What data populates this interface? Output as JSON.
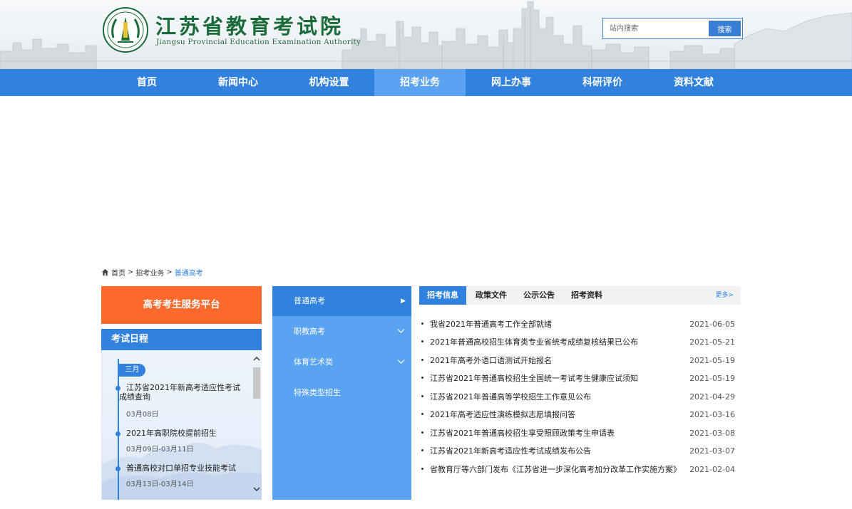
{
  "header": {
    "title": "江苏省教育考试院",
    "subtitle": "Jiangsu Provincial Education Examination Authority",
    "search": {
      "placeholder": "站内搜索",
      "button": "搜索"
    }
  },
  "nav": {
    "items": [
      "首页",
      "新闻中心",
      "机构设置",
      "招考业务",
      "网上办事",
      "科研评价",
      "资料文献"
    ],
    "active": "招考业务"
  },
  "breadcrumb": {
    "home": "首页",
    "section": "招考业务",
    "current": "普通高考"
  },
  "left": {
    "service_button": "高考考生服务平台",
    "schedule_title": "考试日程",
    "month": "三月",
    "events": [
      {
        "title": "江苏省2021年新高考适应性考试成绩查询",
        "date": "03月08日"
      },
      {
        "title": "2021年高职院校提前招生",
        "date": "03月09日-03月11日"
      },
      {
        "title": "普通高校对口单招专业技能考试",
        "date": "03月13日-03月14日"
      }
    ]
  },
  "categories": [
    {
      "label": "普通高考",
      "active": true
    },
    {
      "label": "职教高考"
    },
    {
      "label": "体育艺术类"
    },
    {
      "label": "特殊类型招生"
    }
  ],
  "tabs": [
    "招考信息",
    "政策文件",
    "公示公告",
    "招考资料"
  ],
  "more": "更多>",
  "news": [
    {
      "title": "我省2021年普通高考工作全部就绪",
      "date": "2021-06-05"
    },
    {
      "title": "2021年普通高校招生体育类专业省统考成绩复核结果已公布",
      "date": "2021-05-21"
    },
    {
      "title": "2021年高考外语口语测试开始报名",
      "date": "2021-05-19"
    },
    {
      "title": "江苏省2021年普通高校招生全国统一考试考生健康应试须知",
      "date": "2021-05-19"
    },
    {
      "title": "江苏省2021年普通高等学校招生工作意见公布",
      "date": "2021-04-29"
    },
    {
      "title": "2021年高考适应性演练模拟志愿填报问答",
      "date": "2021-03-16"
    },
    {
      "title": "江苏省2021年普通高校招生享受照顾政策考生申请表",
      "date": "2021-03-08"
    },
    {
      "title": "江苏省2021年新高考适应性考试成绩发布公告",
      "date": "2021-03-07"
    },
    {
      "title": "省教育厅等六部门发布《江苏省进一步深化高考加分改革工作实施方案》",
      "date": "2021-02-04"
    }
  ],
  "colors": {
    "primary": "#3181de",
    "nav_active": "#5aa3f2",
    "accent": "#ff6a2c",
    "logo_green": "#1a6b3a"
  }
}
